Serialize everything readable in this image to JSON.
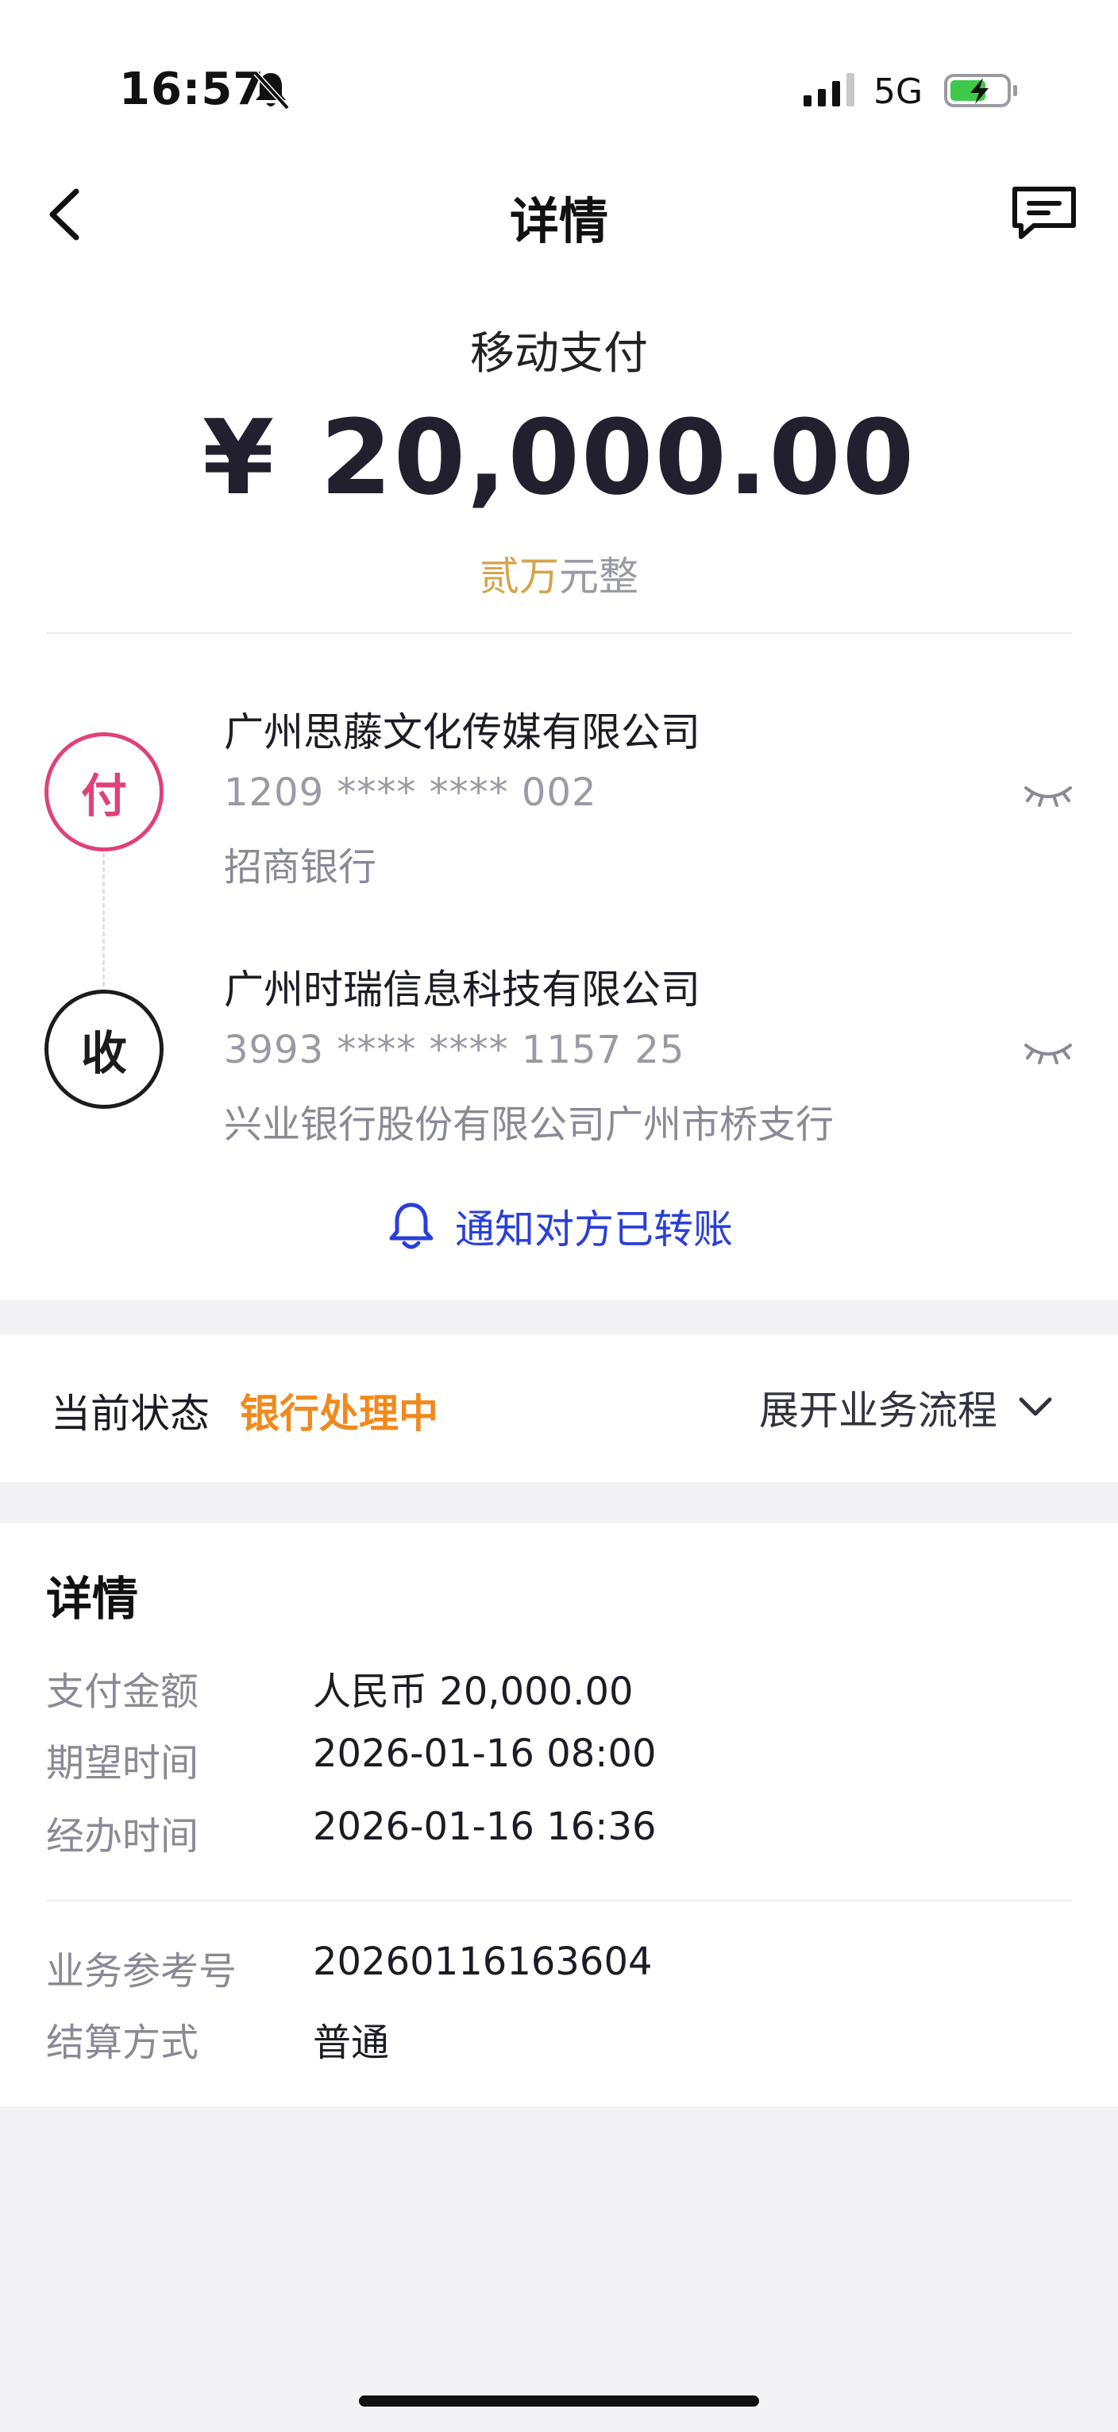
{
  "status_bar": {
    "time": "16:57",
    "network": "5G"
  },
  "nav": {
    "title": "详情"
  },
  "amount": {
    "type_label": "移动支付",
    "currency_symbol": "¥",
    "value": "20,000.00",
    "words_highlight": "贰万",
    "words_rest": "元整"
  },
  "payer": {
    "badge": "付",
    "name": "广州思藤文化传媒有限公司",
    "account": "1209 **** **** 002",
    "bank": "招商银行"
  },
  "payee": {
    "badge": "收",
    "name": "广州时瑞信息科技有限公司",
    "account": "3993 **** **** 1157 25",
    "bank": "兴业银行股份有限公司广州市桥支行"
  },
  "notify_label": "通知对方已转账",
  "status": {
    "label": "当前状态",
    "value": "银行处理中",
    "expand_label": "展开业务流程"
  },
  "details": {
    "title": "详情",
    "rows": [
      {
        "label": "支付金额",
        "value": "人民币 20,000.00"
      },
      {
        "label": "期望时间",
        "value": "2026-01-16 08:00"
      },
      {
        "label": "经办时间",
        "value": "2026-01-16 16:36"
      },
      {
        "label": "业务参考号",
        "value": "20260116163604"
      },
      {
        "label": "结算方式",
        "value": "普通"
      }
    ]
  },
  "colors": {
    "payer_accent": "#e0417a",
    "status_orange": "#f08a1c",
    "link_blue": "#2a3fd8",
    "words_gold": "#d4a44a"
  },
  "icons": [
    "bell-off-icon",
    "signal-icon",
    "battery-charging-icon",
    "back-arrow-icon",
    "message-icon",
    "eye-closed-icon",
    "bell-icon",
    "chevron-down-icon"
  ]
}
